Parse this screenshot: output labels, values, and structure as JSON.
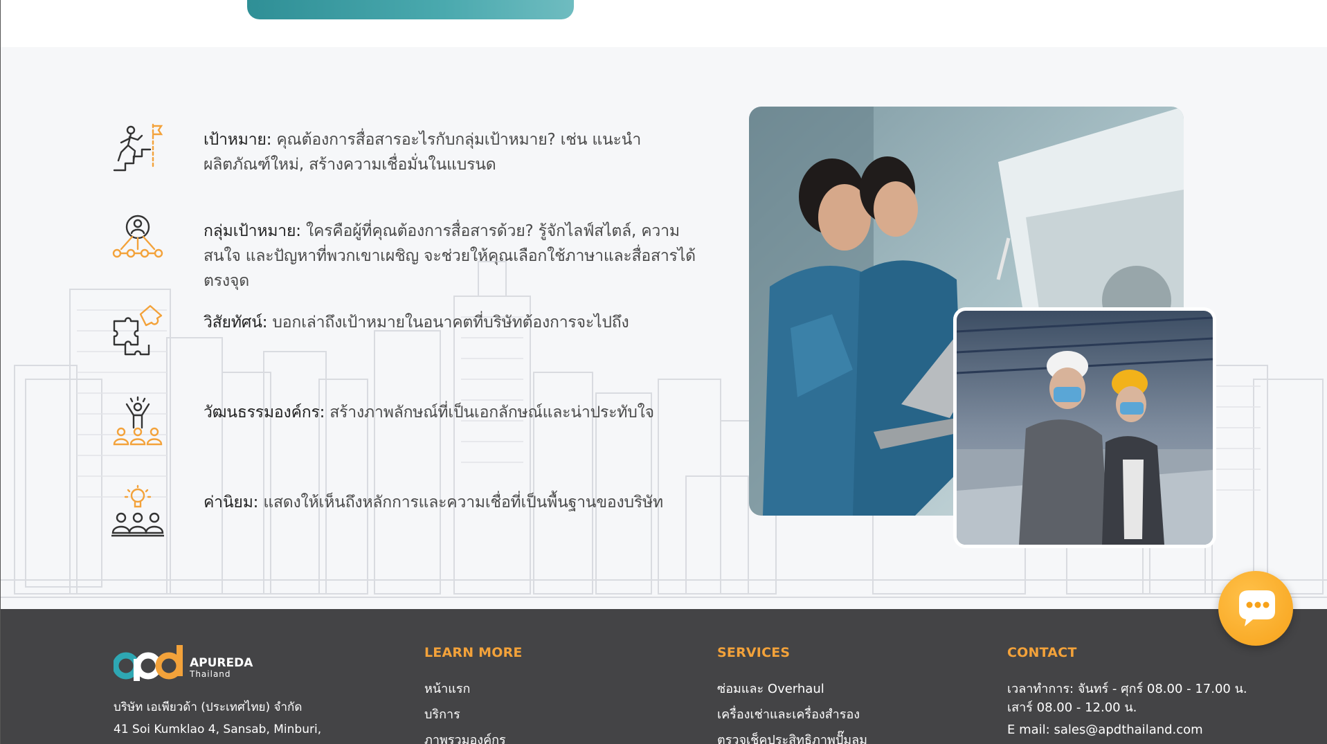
{
  "features": [
    {
      "term": "เป้าหมาย:",
      "text": " คุณต้องการสื่อสารอะไรกับกลุ่มเป้าหมาย? เช่น แนะนำผลิตภัณฑ์ใหม่, สร้างความเชื่อมั่นในแบรนด",
      "icon": "climb-goal-flag-icon"
    },
    {
      "term": "กลุ่มเป้าหมาย:",
      "text": " ใครคือผู้ที่คุณต้องการสื่อสารด้วย? รู้จักไลฟ์สไตล์, ความสนใจ และปัญหาที่พวกเขาเผชิญ จะช่วยให้คุณเลือกใช้ภาษาและสื่อสารได้ตรงจุด",
      "icon": "target-audience-network-icon"
    },
    {
      "term": "วิสัยทัศน์:",
      "text": " บอกเล่าถึงเป้าหมายในอนาคตที่บริษัทต้องการจะไปถึง",
      "icon": "puzzle-vision-icon"
    },
    {
      "term": "วัฒนธรรมองค์กร:",
      "text": " สร้างภาพลักษณ์ที่เป็นเอกลักษณ์และน่าประทับใจ",
      "icon": "team-leader-culture-icon"
    },
    {
      "term": "ค่านิยม:",
      "text": " แสดงให้เห็นถึงหลักการและความเชื่อที่เป็นพื้นฐานของบริษัท",
      "icon": "lightbulb-team-values-icon"
    }
  ],
  "footer": {
    "logo": {
      "name": "APUREDA",
      "sub": "Thailand",
      "mark": "apd"
    },
    "company_name": "บริษัท เอเพียวด้า (ประเทศไทย) จำกัด",
    "address_line1": "41 Soi Kumklao 4, Sansab, Minburi,",
    "learn_more": {
      "title": "LEARN MORE",
      "links": [
        "หน้าแรก",
        "บริการ",
        "ภาพรวมองค์กร"
      ]
    },
    "services": {
      "title": "SERVICES",
      "links": [
        "ซ่อมและ Overhaul",
        "เครื่องเช่าและเครื่องสำรอง",
        "ตรวจเช็คประสิทธิภาพปั๊มลม"
      ]
    },
    "contact": {
      "title": "CONTACT",
      "hours_weekday": "เวลาทำการ: จันทร์ - ศุกร์ 08.00 - 17.00 น.",
      "hours_saturday": "เสาร์ 08.00 - 12.00 น.",
      "email": "E mail: sales@apdthailand.com"
    }
  },
  "colors": {
    "accent": "#f3a23a",
    "footer_bg": "#444446",
    "section_bg": "#f6f7f9",
    "chat": "#f7a21a"
  },
  "chat_button": {
    "icon": "chat-bubble-icon"
  }
}
